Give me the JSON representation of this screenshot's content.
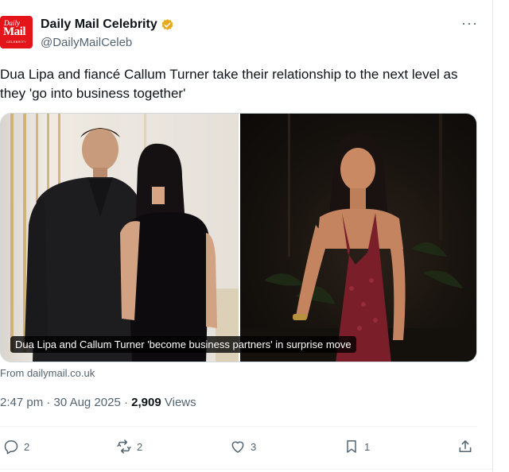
{
  "author": {
    "avatar_text": [
      "Daily",
      "Mail",
      "CELEBRITY"
    ],
    "display_name": "Daily Mail Celebrity",
    "handle": "@DailyMailCeleb",
    "verified_color": "#e8a81b"
  },
  "tweet": {
    "text": "Dua Lipa and fiancé Callum Turner take their relationship to the next level as they 'go into business together'"
  },
  "card": {
    "caption": "Dua Lipa and Callum Turner 'become business partners' in surprise move",
    "source": "From dailymail.co.uk"
  },
  "meta": {
    "time": "2:47 pm",
    "separator": "·",
    "date": "30 Aug 2025",
    "views_count": "2,909",
    "views_label": "Views"
  },
  "actions": {
    "reply_count": "2",
    "repost_count": "2",
    "like_count": "3",
    "bookmark_count": "1"
  },
  "icons": [
    "more-icon",
    "verified-badge-icon",
    "reply-icon",
    "repost-icon",
    "like-icon",
    "bookmark-icon",
    "share-icon"
  ],
  "colors": {
    "accent_red": "#e4141b",
    "muted": "#536471",
    "text": "#0f1419"
  }
}
